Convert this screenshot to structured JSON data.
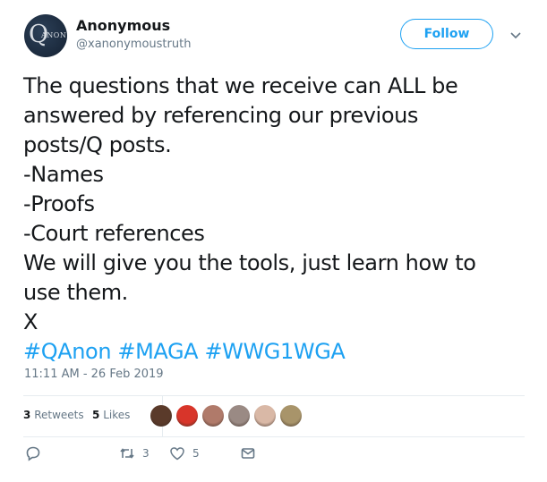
{
  "author": {
    "display_name": "Anonymous",
    "handle": "@xanonymoustruth",
    "avatar_text_q": "Q",
    "avatar_text_anon": "ANON"
  },
  "follow_button": {
    "label": "Follow"
  },
  "menu": {
    "icon": "chevron-down-icon"
  },
  "tweet": {
    "lines": [
      "The questions that we receive can ALL be",
      "answered by referencing our previous",
      "posts/Q posts.",
      "-Names",
      "-Proofs",
      "-Court references",
      "We will give you the tools, just learn how to",
      "use them.",
      "X"
    ],
    "hashtags": [
      "#QAnon",
      "#MAGA",
      "#WWG1WGA"
    ]
  },
  "timestamp": "11:11 AM - 26 Feb 2019",
  "stats": {
    "retweets_count": "3",
    "retweets_label": "Retweets",
    "likes_count": "5",
    "likes_label": "Likes"
  },
  "likers": [
    {
      "name": "liker-avatar-1",
      "color": "#5a3a2a"
    },
    {
      "name": "liker-avatar-2",
      "color": "#d8352a"
    },
    {
      "name": "liker-avatar-3",
      "color": "#b07a6a"
    },
    {
      "name": "liker-avatar-4",
      "color": "#9a8a84"
    },
    {
      "name": "liker-avatar-5",
      "color": "#d9b8a6"
    },
    {
      "name": "liker-avatar-6",
      "color": "#a8946a"
    }
  ],
  "actions": {
    "reply": {
      "icon": "reply-icon",
      "count": ""
    },
    "retweet": {
      "icon": "retweet-icon",
      "count": "3"
    },
    "like": {
      "icon": "heart-icon",
      "count": "5"
    },
    "dm": {
      "icon": "envelope-icon",
      "count": ""
    }
  },
  "colors": {
    "accent": "#1da1f2",
    "secondary_text": "#657786",
    "primary_text": "#14171a",
    "divider": "#e6ecf0"
  }
}
